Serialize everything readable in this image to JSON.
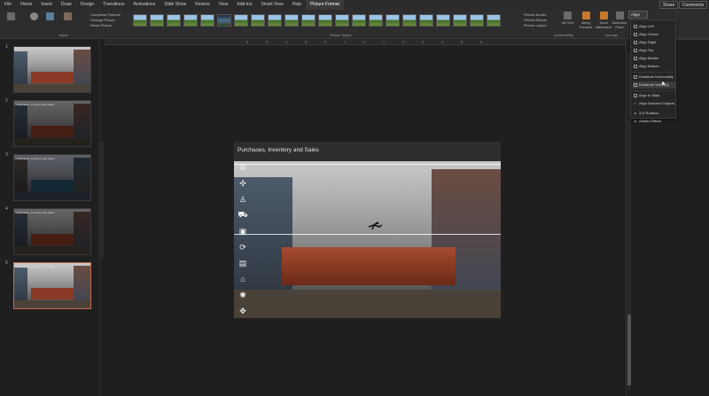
{
  "menu_tabs": [
    "File",
    "Home",
    "Insert",
    "Draw",
    "Design",
    "Transitions",
    "Animations",
    "Slide Show",
    "Review",
    "View",
    "Add-ins",
    "Smart View",
    "Help",
    "Picture Format"
  ],
  "active_tab": "Picture Format",
  "share_label": "Share",
  "comments_label": "Comments",
  "ribbon": {
    "adjust_label": "Adjust",
    "picture_styles_label": "Picture Styles",
    "arrange_label": "Arrange",
    "accessibility_label": "Accessibility",
    "small_commands": [
      "Compress Pictures",
      "Change Picture",
      "Reset Picture"
    ],
    "picture_commands": [
      "Picture Border",
      "Picture Effects",
      "Picture Layout"
    ],
    "arrange_buttons": [
      "Alt Text",
      "Bring Forward",
      "Send Backward",
      "Selection Pane"
    ],
    "align_button": "Align"
  },
  "ruler_ticks": [
    "6",
    "5",
    "4",
    "3",
    "2",
    "1",
    "0",
    "1",
    "2",
    "3",
    "4",
    "5",
    "6"
  ],
  "slides": [
    {
      "num": "1",
      "title": "",
      "variant": "photo"
    },
    {
      "num": "2",
      "title": "Purchases, Inventory and Sales",
      "variant": "dark"
    },
    {
      "num": "3",
      "title": "Purchases, Inventory and Sales",
      "variant": "blue"
    },
    {
      "num": "4",
      "title": "Purchases, Inventory and Sales",
      "variant": "dark"
    },
    {
      "num": "5",
      "title": "Purchases, Inventory and Sales",
      "variant": "photo",
      "active": true
    }
  ],
  "main_slide": {
    "title": "Purchases, Inventory and Sales"
  },
  "align_menu": {
    "header": "Align",
    "items": [
      "Align Left",
      "Align Center",
      "Align Right",
      "Align Top",
      "Align Middle",
      "Align Bottom",
      "Distribute Horizontally",
      "Distribute Vertically",
      "Align to Slide",
      "Align Selected Objects"
    ],
    "highlighted": "Distribute Vertically",
    "checked": "Align Selected Objects",
    "submenus": [
      "3-D Rotation",
      "Artistic Effects"
    ]
  },
  "colors": {
    "accent": "#c43e1c",
    "background": "#1f1f1f",
    "ribbon": "#2d2d2d"
  }
}
